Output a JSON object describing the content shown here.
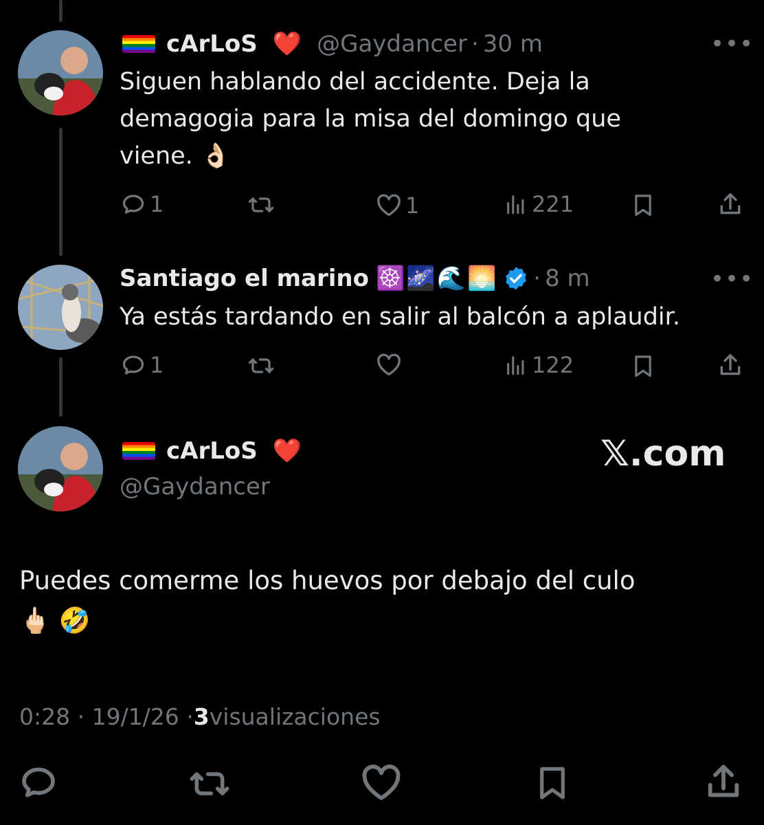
{
  "tweets": [
    {
      "name": "cArLoS",
      "handle": "@Gaydancer",
      "time": "30 m",
      "text_lines": [
        "Siguen hablando del accidente. Deja la",
        "demagogia para la misa del domingo que",
        "viene."
      ],
      "text_emoji": "👌🏻",
      "stats": {
        "replies": "1",
        "likes": "1",
        "views": "221"
      }
    },
    {
      "name": "Santiago el marino",
      "name_emojis": "☸️🌌🌊🌅",
      "handle": "",
      "time": "8 m",
      "text_lines": [
        "Ya estás tardando en salir al balcón a aplaudir."
      ],
      "stats": {
        "replies": "1",
        "views": "122"
      }
    }
  ],
  "main_tweet": {
    "name": "cArLoS",
    "handle": "@Gaydancer",
    "watermark": "𝕏.com",
    "text": "Puedes comerme los huevos por debajo del culo",
    "text_emojis": "🖕🏻 🤣",
    "timestamp": "0:28 · 19/1/26 · ",
    "views_count": "3",
    "views_label": " visualizaciones"
  },
  "icons": [
    "reply-icon",
    "retweet-icon",
    "like-icon",
    "views-icon",
    "bookmark-icon",
    "share-icon",
    "more-icon",
    "verified-icon"
  ],
  "colors": {
    "background": "#000000",
    "text": "#e7e9ea",
    "muted": "#71767b",
    "verified": "#1d9bf0",
    "heart": "#e0245e"
  }
}
